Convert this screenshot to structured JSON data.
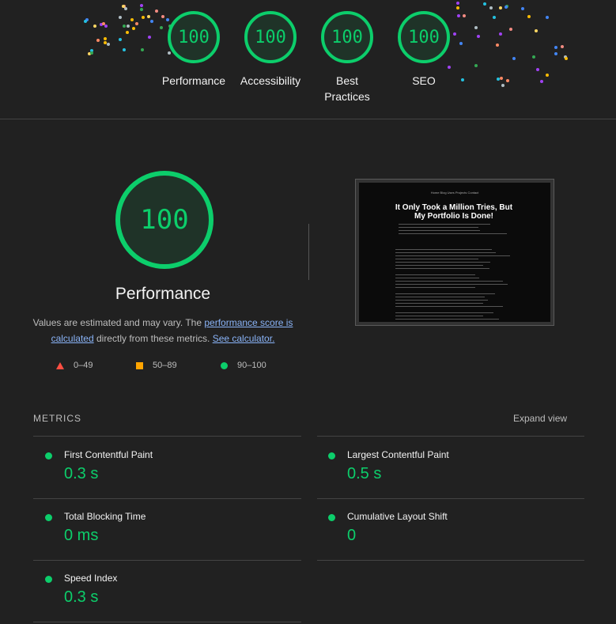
{
  "colors": {
    "pass": "#0cce6b",
    "average": "#ffa400",
    "fail": "#ff4e42",
    "background": "#212121",
    "link": "#8ab4f8"
  },
  "categories": [
    {
      "score": "100",
      "label": "Performance"
    },
    {
      "score": "100",
      "label": "Accessibility"
    },
    {
      "score": "100",
      "label": "Best Practices"
    },
    {
      "score": "100",
      "label": "SEO"
    }
  ],
  "performance": {
    "score": "100",
    "title": "Performance",
    "desc_prefix": "Values are estimated and may vary. The ",
    "desc_link1": "performance score is calculated",
    "desc_middle": " directly from these metrics. ",
    "desc_link2": "See calculator."
  },
  "legend": [
    {
      "shape": "triangle",
      "range": "0–49"
    },
    {
      "shape": "square",
      "range": "50–89"
    },
    {
      "shape": "circle",
      "range": "90–100"
    }
  ],
  "screenshot": {
    "title": "It Only Took a Million Tries, But My Portfolio Is Done!",
    "nav": "Home   Blog   Uses   Projects   Contact"
  },
  "metrics": {
    "header": "METRICS",
    "expand": "Expand view",
    "items": [
      {
        "label": "First Contentful Paint",
        "value": "0.3 s"
      },
      {
        "label": "Largest Contentful Paint",
        "value": "0.5 s"
      },
      {
        "label": "Total Blocking Time",
        "value": "0 ms"
      },
      {
        "label": "Cumulative Layout Shift",
        "value": "0"
      },
      {
        "label": "Speed Index",
        "value": "0.3 s"
      }
    ]
  }
}
